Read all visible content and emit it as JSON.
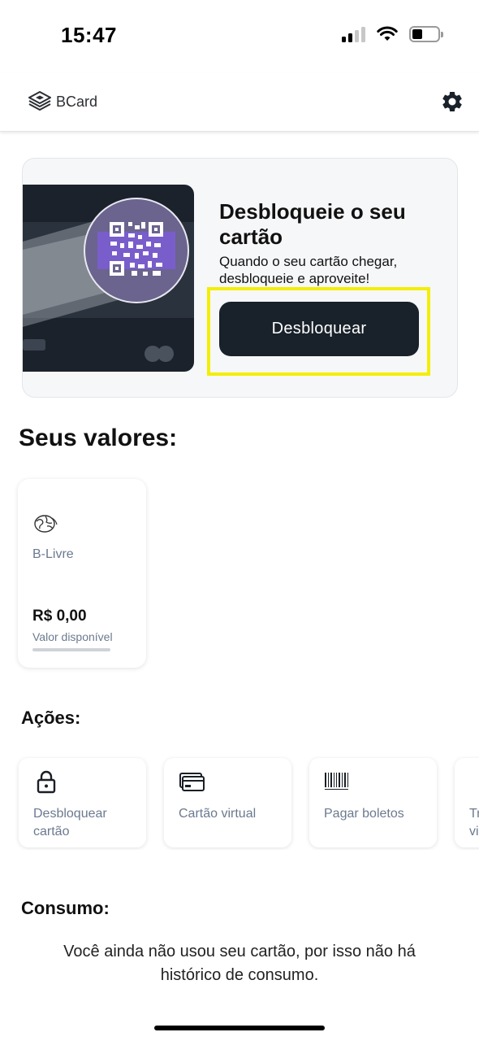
{
  "status_bar": {
    "time": "15:47"
  },
  "header": {
    "logo_text": "BCard"
  },
  "unlock": {
    "title": "Desbloqueie o seu cartão",
    "description": "Quando o seu cartão chegar, desbloqueie e aproveite!",
    "button_label": "Desbloquear"
  },
  "values": {
    "title": "Seus valores:",
    "cards": [
      {
        "name": "B-Livre",
        "amount": "R$ 0,00",
        "label": "Valor disponível",
        "icon": "globe-icon"
      }
    ]
  },
  "actions": {
    "title": "Ações:",
    "items": [
      {
        "label": "Desbloquear cartão",
        "icon": "lock-icon"
      },
      {
        "label": "Cartão virtual",
        "icon": "card-icon"
      },
      {
        "label": "Pagar boletos",
        "icon": "barcode-icon"
      },
      {
        "label": "Tr vi",
        "icon": "transfer-icon"
      }
    ]
  },
  "consumo": {
    "title": "Consumo:",
    "text": "Você ainda não usou seu cartão, por isso não há histórico de consumo."
  },
  "colors": {
    "primary_dark": "#19212a",
    "muted_text": "#6b7a8f",
    "highlight": "#f3ee06",
    "qr_purple": "#7b5cd6"
  }
}
